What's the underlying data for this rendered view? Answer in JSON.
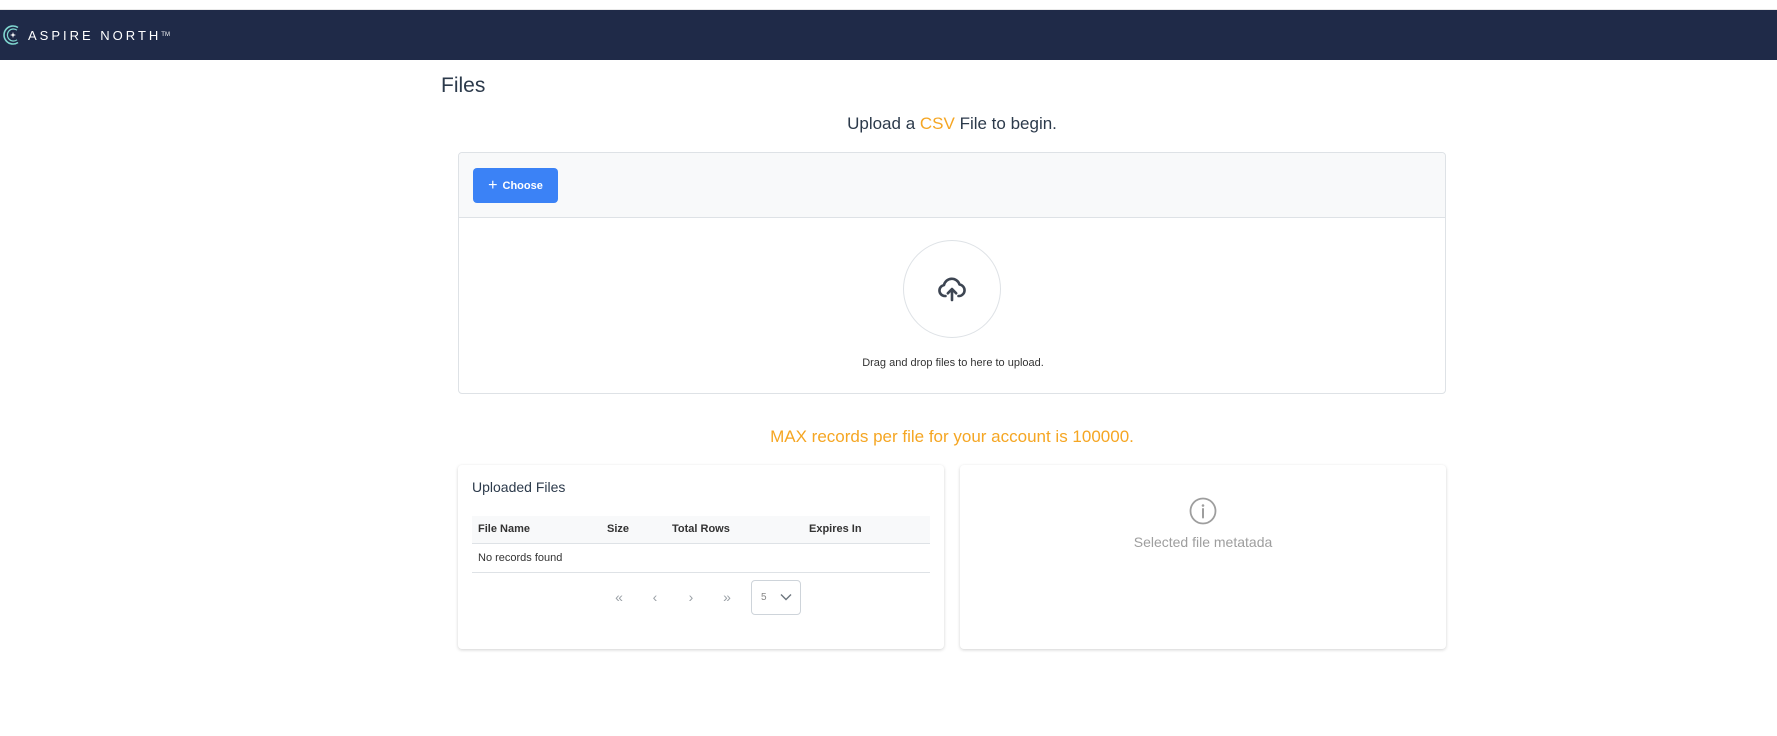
{
  "header": {
    "brand": "ASPIRE NORTH",
    "brand_tm": "TM"
  },
  "page": {
    "title": "Files",
    "subtitle_before": "Upload a ",
    "subtitle_highlight": "CSV",
    "subtitle_after": " File to begin.",
    "accent_color": "#f5a623"
  },
  "upload": {
    "choose_label": "Choose",
    "choose_icon": "plus-icon",
    "upload_icon": "cloud-upload-icon",
    "hint": "Drag and drop files to here to upload."
  },
  "limits": {
    "text": "MAX records per file for your account is 100000."
  },
  "uploaded_files": {
    "title": "Uploaded Files",
    "columns": [
      "File Name",
      "Size",
      "Total Rows",
      "Expires In"
    ],
    "empty_message": "No records found",
    "paginator": {
      "first": "«",
      "prev": "‹",
      "next": "›",
      "last": "»",
      "rows_per_page": "5"
    }
  },
  "metadata": {
    "icon": "info-icon",
    "placeholder": "Selected file metatada"
  }
}
